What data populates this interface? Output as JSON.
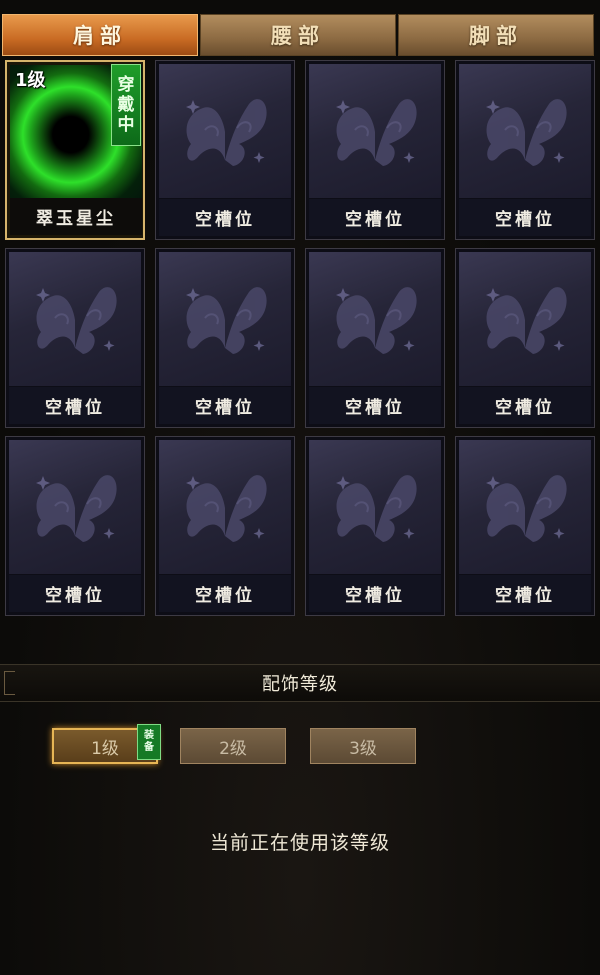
{
  "tabs": [
    {
      "label": "肩部",
      "active": true
    },
    {
      "label": "腰部",
      "active": false
    },
    {
      "label": "脚部",
      "active": false
    }
  ],
  "slots": [
    {
      "label": "翠玉星尘",
      "level": "1级",
      "wear_badge": [
        "穿",
        "戴",
        "中"
      ],
      "equipped": true
    },
    {
      "label": "空槽位"
    },
    {
      "label": "空槽位"
    },
    {
      "label": "空槽位"
    },
    {
      "label": "空槽位"
    },
    {
      "label": "空槽位"
    },
    {
      "label": "空槽位"
    },
    {
      "label": "空槽位"
    },
    {
      "label": "空槽位"
    },
    {
      "label": "空槽位"
    },
    {
      "label": "空槽位"
    },
    {
      "label": "空槽位"
    }
  ],
  "section": {
    "title": "配饰等级"
  },
  "levels": [
    {
      "label": "1级",
      "active": true
    },
    {
      "label": "2级",
      "active": false
    },
    {
      "label": "3级",
      "active": false
    }
  ],
  "equip_badge": [
    "装",
    "备"
  ],
  "status": "当前正在使用该等级",
  "colors": {
    "accent": "#e6b555",
    "equipped_green": "#1f9d2a",
    "tab_active": "#d97a30"
  }
}
